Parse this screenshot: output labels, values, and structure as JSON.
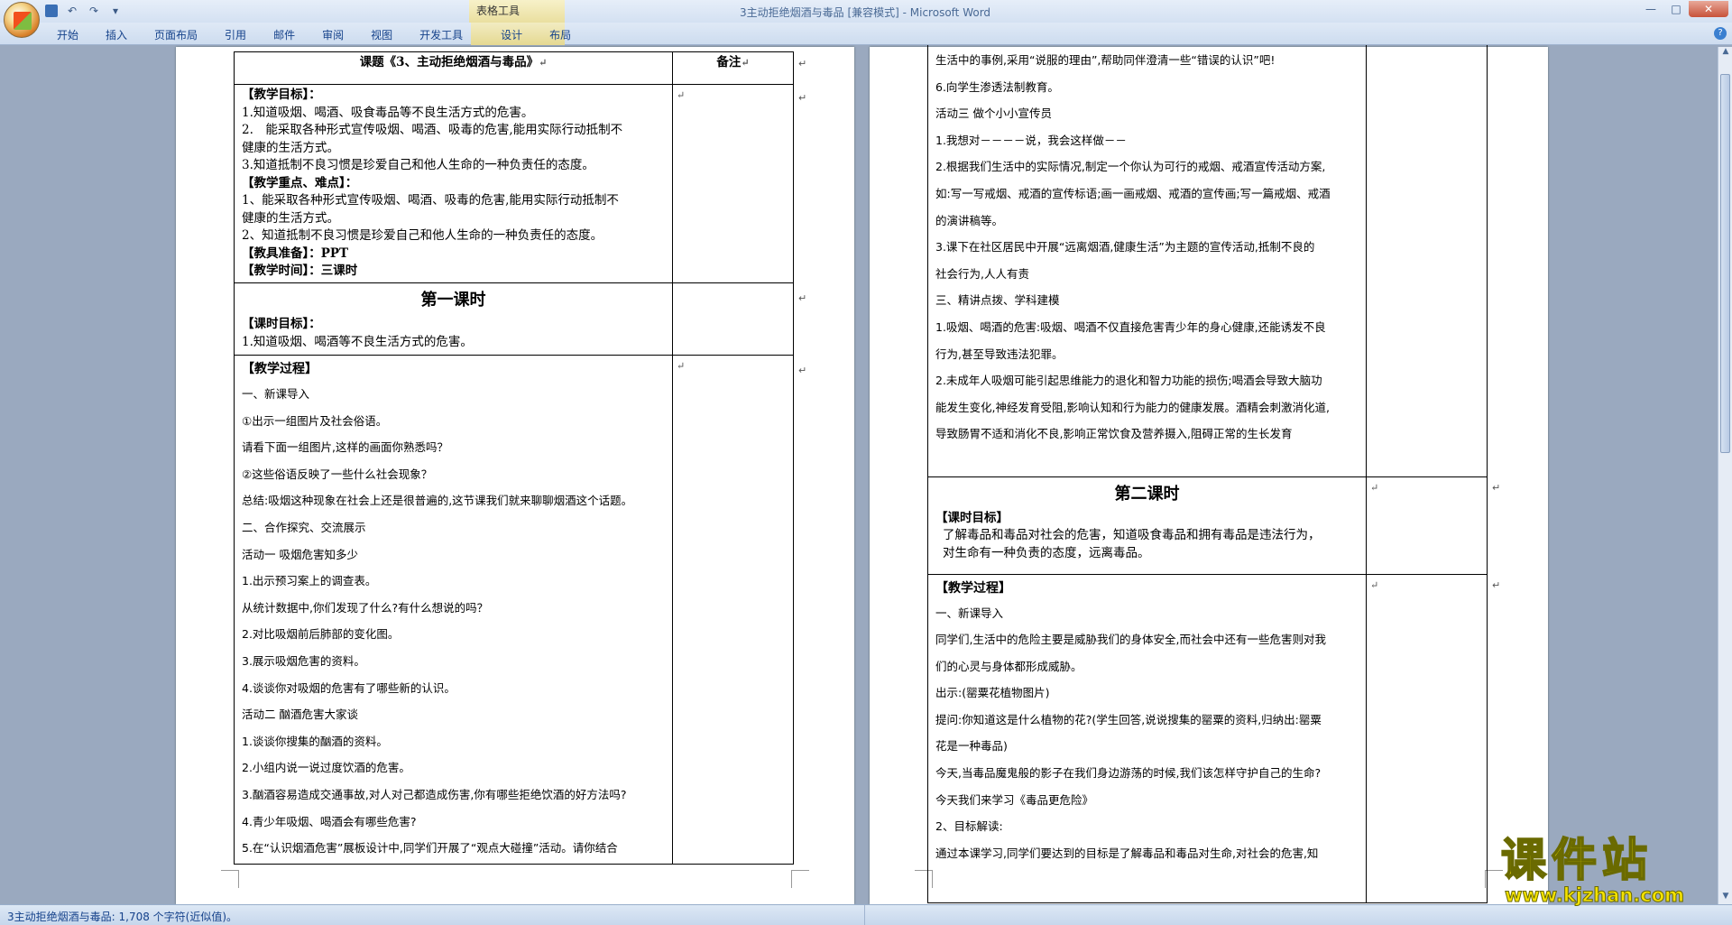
{
  "app": {
    "window_title": "3主动拒绝烟酒与毒品 [兼容模式] - Microsoft Word",
    "context_tools": "表格工具",
    "qat": {
      "undo": "↶",
      "redo": "↷",
      "more": "▾"
    },
    "window_controls": {
      "minimize": "—",
      "maximize": "□",
      "close": "✕"
    }
  },
  "tabs": [
    "开始",
    "插入",
    "页面布局",
    "引用",
    "邮件",
    "审阅",
    "视图",
    "开发工具",
    "设计",
    "布局"
  ],
  "status": {
    "text": "3主动拒绝烟酒与毒品: 1,708 个字符(近似值)。"
  },
  "watermark": {
    "main": "课件站",
    "url": "www.kjzhan.com"
  },
  "left_page": {
    "header_title": "课题《3、主动拒绝烟酒与毒品》",
    "header_note": "备注",
    "goals": [
      "【教学目标】：",
      "1.知道吸烟、喝酒、吸食毒品等不良生活方式的危害。",
      "2.　能采取各种形式宣传吸烟、喝酒、吸毒的危害,能用实际行动抵制不",
      "健康的生活方式。",
      "3.知道抵制不良习惯是珍爱自己和他人生命的一种负责任的态度。",
      "【教学重点、难点】：",
      "1、能采取各种形式宣传吸烟、喝酒、吸毒的危害,能用实际行动抵制不",
      "健康的生活方式。",
      "2、知道抵制不良习惯是珍爱自己和他人生命的一种负责任的态度。",
      "【教具准备】：PPT",
      "【教学时间】：三课时"
    ],
    "lesson1_title": "第一课时",
    "lesson1_goal_label": "【课时目标】：",
    "lesson1_goal": "1.知道吸烟、喝酒等不良生活方式的危害。",
    "process_label": "【教学过程】",
    "process_lines": [
      "一、新课导入",
      "①出示一组图片及社会俗语。",
      "请看下面一组图片,这样的画面你熟悉吗？",
      "②这些俗语反映了一些什么社会现象？",
      "总结:吸烟这种现象在社会上还是很普遍的,这节课我们就来聊聊烟酒这个话题。",
      "二、合作探究、交流展示",
      "活动一 吸烟危害知多少",
      "1.出示预习案上的调查表。",
      "从统计数据中,你们发现了什么?有什么想说的吗？",
      "2.对比吸烟前后肺部的变化图。",
      "3.展示吸烟危害的资料。",
      "4.谈谈你对吸烟的危害有了哪些新的认识。",
      "活动二 酗酒危害大家谈",
      "1.谈谈你搜集的酗酒的资料。",
      "2.小组内说一说过度饮酒的危害。",
      "3.酗酒容易造成交通事故,对人对己都造成伤害,你有哪些拒绝饮酒的好方法吗?",
      "4.青少年吸烟、喝酒会有哪些危害?",
      "5.在“认识烟酒危害”展板设计中,同学们开展了“观点大碰撞”活动。请你结合"
    ]
  },
  "right_page": {
    "upper_lines": [
      "生活中的事例,采用“说服的理由”,帮助同伴澄清一些“错误的认识”吧!",
      "6.向学生渗透法制教育。",
      "活动三 做个小小宣传员",
      "1.我想对－－－－说，我会这样做－－",
      "2.根据我们生活中的实际情况,制定一个你认为可行的戒烟、戒酒宣传活动方案,",
      "如:写一写戒烟、戒酒的宣传标语;画一画戒烟、戒酒的宣传画;写一篇戒烟、戒酒",
      "的演讲稿等。",
      "3.课下在社区居民中开展“远离烟酒,健康生活”为主题的宣传活动,抵制不良的",
      "社会行为,人人有责",
      "三、精讲点拨、学科建模",
      "1.吸烟、喝酒的危害:吸烟、喝酒不仅直接危害青少年的身心健康,还能诱发不良",
      "行为,甚至导致违法犯罪。",
      "2.未成年人吸烟可能引起思维能力的退化和智力功能的损伤;喝酒会导致大脑功",
      "能发生变化,神经发育受阻,影响认知和行为能力的健康发展。酒精会刺激消化道,",
      "导致肠胃不适和消化不良,影响正常饮食及营养摄入,阻碍正常的生长发育",
      ""
    ],
    "lesson2_title": "第二课时",
    "lesson2_goal_label": "【课时目标】",
    "lesson2_goal_lines": [
      "了解毒品和毒品对社会的危害，知道吸食毒品和拥有毒品是违法行为，",
      "对生命有一种负责的态度，远离毒品。"
    ],
    "process_label": "【教学过程】",
    "process_lines": [
      "一、新课导入",
      "同学们,生活中的危险主要是威胁我们的身体安全,而社会中还有一些危害则对我",
      "们的心灵与身体都形成威胁。",
      "出示:(罂粟花植物图片)",
      "提问:你知道这是什么植物的花?(学生回答,说说搜集的罂粟的资料,归纳出:罂粟",
      "花是一种毒品)",
      "今天,当毒品魔鬼般的影子在我们身边游荡的时候,我们该怎样守护自己的生命?",
      "今天我们来学习《毒品更危险》",
      "2、目标解读:",
      "通过本课学习,同学们要达到的目标是了解毒品和毒品对生命,对社会的危害,知"
    ]
  }
}
